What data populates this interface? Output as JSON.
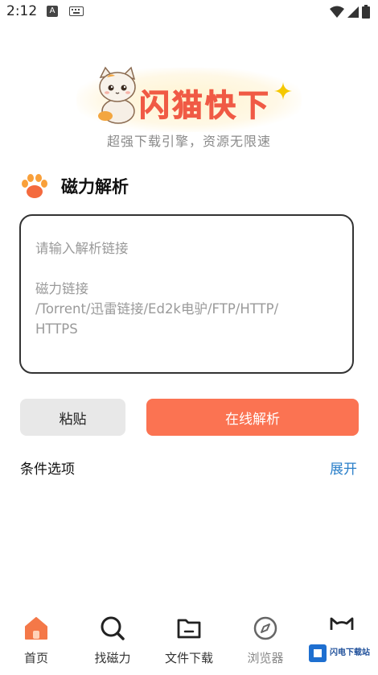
{
  "status_bar": {
    "time": "2:12",
    "a_badge": "A"
  },
  "header": {
    "logo_text": "闪猫快下",
    "subtitle": "超强下载引擎，资源无限速"
  },
  "section": {
    "title": "磁力解析"
  },
  "input": {
    "placeholder_line1": "请输入解析链接",
    "placeholder_rest": "磁力链接\n/Torrent/迅雷链接/Ed2k电驴/FTP/HTTP/\nHTTPS"
  },
  "buttons": {
    "paste": "粘贴",
    "parse": "在线解析"
  },
  "conditions": {
    "label": "条件选项",
    "toggle": "展开"
  },
  "nav": {
    "items": [
      {
        "label": "首页",
        "icon": "home-icon"
      },
      {
        "label": "找磁力",
        "icon": "search-icon"
      },
      {
        "label": "文件下载",
        "icon": "folder-icon"
      },
      {
        "label": "浏览器",
        "icon": "compass-icon"
      },
      {
        "label": "",
        "icon": "cat-icon"
      }
    ]
  },
  "watermark": {
    "title": "闪电下载站"
  },
  "colors": {
    "accent": "#fb7352",
    "link": "#2a7fc9",
    "logo": "#f05a45"
  }
}
